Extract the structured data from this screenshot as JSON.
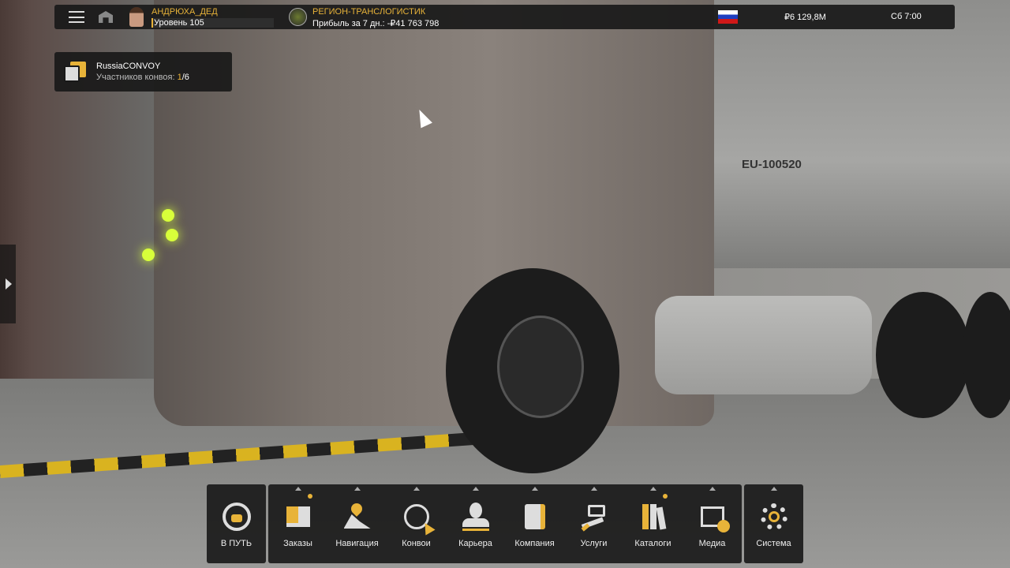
{
  "topbar": {
    "player_name": "АНДРЮХА_ДЕД",
    "level": "Уровень 105",
    "company": "РЕГИОН-ТРАНСЛОГИСТИК",
    "profit": "Прибыль за 7 дн.: -₽41 763 798",
    "money": "₽6 129,8M",
    "time": "Сб 7:00"
  },
  "convoy": {
    "name": "RussiaCONVOY",
    "members_label": "Участников конвоя: ",
    "members_current": "1",
    "members_total": "/6"
  },
  "scene": {
    "trailer_plate": "EU-100520"
  },
  "menu": {
    "drive": "В ПУТЬ",
    "items": [
      "Заказы",
      "Навигация",
      "Конвои",
      "Карьера",
      "Компания",
      "Услуги",
      "Каталоги",
      "Медиа"
    ],
    "system": "Система"
  },
  "colors": {
    "accent": "#e8b339",
    "panel": "#191919"
  }
}
